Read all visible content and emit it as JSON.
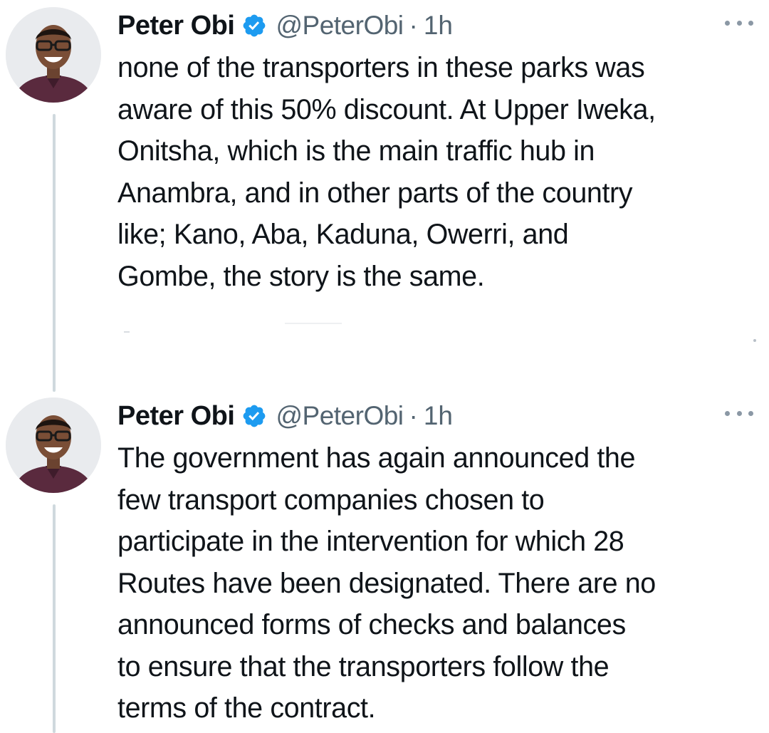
{
  "tweets": [
    {
      "author": {
        "name": "Peter Obi",
        "handle": "@PeterObi",
        "verified": true
      },
      "separator": "·",
      "time": "1h",
      "text": "none of the transporters in these parks was\naware of this 50% discount. At Upper Iweka,\nOnitsha, which is the main traffic hub in\nAnambra, and in other parts of the country\nlike; Kano, Aba, Kaduna, Owerri, and\nGombe, the story is the same."
    },
    {
      "author": {
        "name": "Peter Obi",
        "handle": "@PeterObi",
        "verified": true
      },
      "separator": "·",
      "time": "1h",
      "text": "The government has again announced the\nfew transport companies chosen to\nparticipate in the intervention for which 28\nRoutes have been designated. There are no\nannounced forms of checks and balances\nto ensure that the transporters follow the\nterms of the contract."
    }
  ],
  "colors": {
    "verified_badge": "#1d9bf0",
    "thread_line": "#cfd9de",
    "secondary_text": "#536471",
    "primary_text": "#0f1419"
  },
  "icons": {
    "verified": "verified-badge-icon",
    "more": "more-horizontal-icon",
    "avatar": "avatar"
  }
}
